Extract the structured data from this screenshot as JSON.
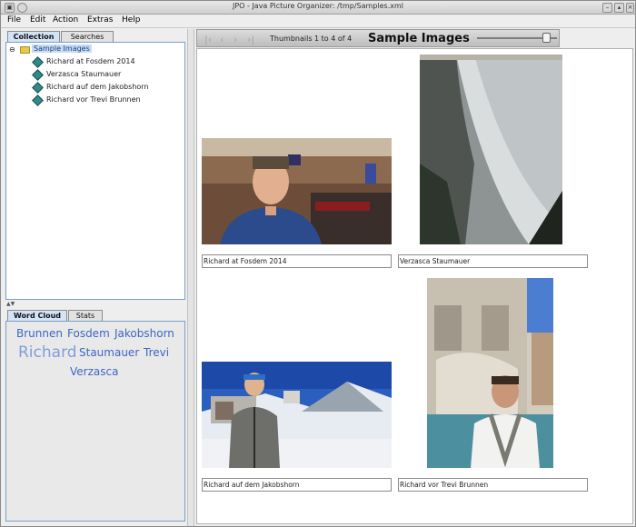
{
  "window": {
    "title": "JPO - Java Picture Organizer:  /tmp/Samples.xml"
  },
  "menu": [
    "File",
    "Edit",
    "Action",
    "Extras",
    "Help"
  ],
  "left_tabs": {
    "collection": "Collection",
    "searches": "Searches"
  },
  "tree": {
    "root": "Sample Images",
    "items": [
      "Richard at Fosdem 2014",
      "Verzasca Staumauer",
      "Richard auf dem Jakobshorn",
      "Richard vor Trevi Brunnen"
    ]
  },
  "bottom_tabs": {
    "word_cloud": "Word Cloud",
    "stats": "Stats"
  },
  "word_cloud": {
    "words": [
      {
        "text": "Brunnen",
        "weight": "medium"
      },
      {
        "text": "Fosdem",
        "weight": "medium"
      },
      {
        "text": "Jakobshorn",
        "weight": "medium"
      },
      {
        "text": "Richard",
        "weight": "large"
      },
      {
        "text": "Staumauer",
        "weight": "medium"
      },
      {
        "text": "Trevi",
        "weight": "medium"
      },
      {
        "text": "Verzasca",
        "weight": "medium"
      }
    ]
  },
  "toolbar": {
    "count_text": "Thumbnails 1 to 4 of 4",
    "group_title": "Sample Images",
    "nav_icons": [
      "first-icon",
      "previous-icon",
      "next-icon",
      "last-icon"
    ]
  },
  "thumbnails": [
    {
      "caption": "Richard at Fosdem 2014"
    },
    {
      "caption": "Verzasca Staumauer"
    },
    {
      "caption": "Richard auf dem Jakobshorn"
    },
    {
      "caption": "Richard vor Trevi Brunnen"
    }
  ],
  "colors": {
    "accent": "#3d66c4",
    "selection": "#c7dbf4"
  }
}
